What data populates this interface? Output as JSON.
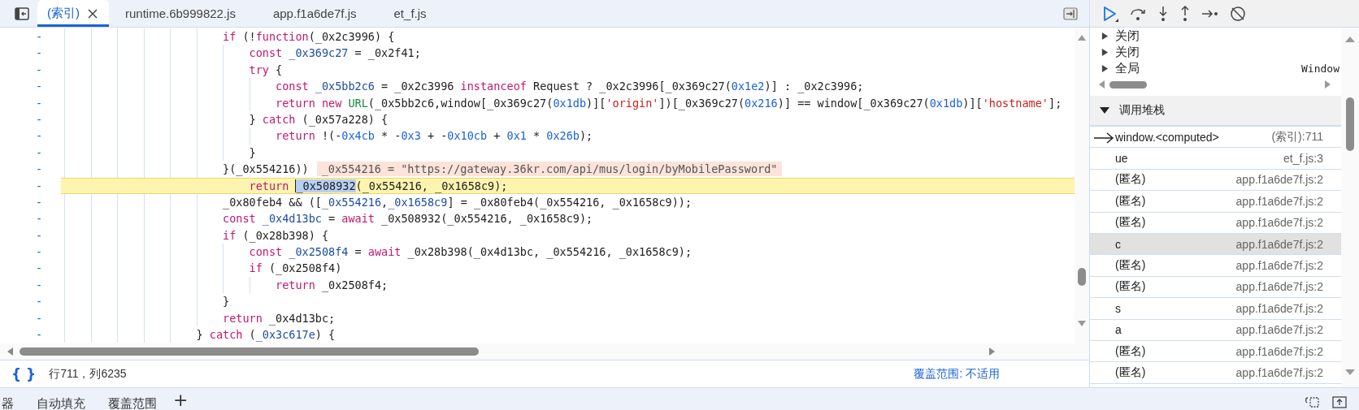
{
  "editor": {
    "tabs": [
      {
        "label": "(索引)",
        "selected": true
      },
      {
        "label": "runtime.6b999822.js",
        "selected": false
      },
      {
        "label": "app.f1a6de7f.js",
        "selected": false
      },
      {
        "label": "et_f.js",
        "selected": false
      }
    ],
    "lines": [
      {
        "kind": "code",
        "gutter": "-",
        "current": false,
        "tokens": [
          {
            "t": "if",
            "kind": "kw"
          },
          {
            "t": " (!",
            "kind": "p"
          },
          {
            "t": "function",
            "kind": "kw"
          },
          {
            "t": "(_0x2c3996) {",
            "kind": "p"
          }
        ],
        "children": [
          {
            "kind": "code",
            "gutter": "-",
            "current": false,
            "tokens": [
              {
                "t": "const ",
                "kind": "kw"
              },
              {
                "t": "_0x369c27",
                "kind": "def"
              },
              {
                "t": " = _0x2f41;",
                "kind": "p"
              }
            ]
          },
          {
            "kind": "code",
            "gutter": "-",
            "current": false,
            "tokens": [
              {
                "t": "try",
                "kind": "kw"
              },
              {
                "t": " {",
                "kind": "p"
              }
            ],
            "children": [
              {
                "kind": "code",
                "gutter": "-",
                "current": false,
                "tokens": [
                  {
                    "t": "const ",
                    "kind": "kw"
                  },
                  {
                    "t": "_0x5bb2c6",
                    "kind": "def"
                  },
                  {
                    "t": " = _0x2c3996 ",
                    "kind": "p"
                  },
                  {
                    "t": "instanceof",
                    "kind": "kw"
                  },
                  {
                    "t": " Request ? _0x2c3996[_0x369c27(",
                    "kind": "p"
                  },
                  {
                    "t": "0x1e2",
                    "kind": "num"
                  },
                  {
                    "t": ")] : _0x2c3996;",
                    "kind": "p"
                  }
                ]
              },
              {
                "kind": "code",
                "gutter": "-",
                "current": false,
                "tokens": [
                  {
                    "t": "return new ",
                    "kind": "kw"
                  },
                  {
                    "t": "URL",
                    "kind": "fn"
                  },
                  {
                    "t": "(_0x5bb2c6,window[_0x369c27(",
                    "kind": "p"
                  },
                  {
                    "t": "0x1db",
                    "kind": "num"
                  },
                  {
                    "t": ")][",
                    "kind": "p"
                  },
                  {
                    "t": "'origin'",
                    "kind": "str"
                  },
                  {
                    "t": "])[_0x369c27(",
                    "kind": "p"
                  },
                  {
                    "t": "0x216",
                    "kind": "num"
                  },
                  {
                    "t": ")] == window[_0x369c27(",
                    "kind": "p"
                  },
                  {
                    "t": "0x1db",
                    "kind": "num"
                  },
                  {
                    "t": ")][",
                    "kind": "p"
                  },
                  {
                    "t": "'hostname'",
                    "kind": "str"
                  },
                  {
                    "t": "];",
                    "kind": "p"
                  }
                ]
              }
            ]
          },
          {
            "kind": "code",
            "gutter": "-",
            "current": false,
            "tokens": [
              {
                "t": "} ",
                "kind": "p"
              },
              {
                "t": "catch",
                "kind": "kw"
              },
              {
                "t": " (_0x57a228) {",
                "kind": "p"
              }
            ],
            "children": [
              {
                "kind": "code",
                "gutter": "-",
                "current": false,
                "tokens": [
                  {
                    "t": "return",
                    "kind": "kw"
                  },
                  {
                    "t": " !(-",
                    "kind": "p"
                  },
                  {
                    "t": "0x4cb",
                    "kind": "num"
                  },
                  {
                    "t": " * -",
                    "kind": "p"
                  },
                  {
                    "t": "0x3",
                    "kind": "num"
                  },
                  {
                    "t": " + -",
                    "kind": "p"
                  },
                  {
                    "t": "0x10cb",
                    "kind": "num"
                  },
                  {
                    "t": " + ",
                    "kind": "p"
                  },
                  {
                    "t": "0x1",
                    "kind": "num"
                  },
                  {
                    "t": " * ",
                    "kind": "p"
                  },
                  {
                    "t": "0x26b",
                    "kind": "num"
                  },
                  {
                    "t": ");",
                    "kind": "p"
                  }
                ]
              }
            ]
          },
          {
            "kind": "code",
            "gutter": "-",
            "current": false,
            "tokens": [
              {
                "t": "}",
                "kind": "p"
              }
            ]
          }
        ]
      },
      {
        "kind": "code",
        "gutter": "-",
        "current": false,
        "tokens": [
          {
            "t": "}(_0x554216))",
            "kind": "p"
          }
        ],
        "inline_value": "_0x554216 = \"https://gateway.36kr.com/api/mus/login/byMobilePassword\"",
        "children": [
          {
            "kind": "code",
            "gutter": "-",
            "current": true,
            "tokens": [
              {
                "t": "return ",
                "kind": "kw"
              },
              {
                "t": "_0x508932",
                "kind": "sel"
              },
              {
                "t": "(_0x554216, _0x1658c9);",
                "kind": "p"
              }
            ]
          }
        ]
      },
      {
        "kind": "code",
        "gutter": "-",
        "current": false,
        "tokens": [
          {
            "t": "_0x80feb4 && ([",
            "kind": "p"
          },
          {
            "t": "_0x554216",
            "kind": "def"
          },
          {
            "t": ",",
            "kind": "p"
          },
          {
            "t": "_0x1658c9",
            "kind": "def"
          },
          {
            "t": "] = _0x80feb4(_0x554216, _0x1658c9));",
            "kind": "p"
          }
        ]
      },
      {
        "kind": "code",
        "gutter": "-",
        "current": false,
        "tokens": [
          {
            "t": "const ",
            "kind": "kw"
          },
          {
            "t": "_0x4d13bc",
            "kind": "def"
          },
          {
            "t": " = ",
            "kind": "p"
          },
          {
            "t": "await",
            "kind": "kw"
          },
          {
            "t": " _0x508932(_0x554216, _0x1658c9);",
            "kind": "p"
          }
        ]
      },
      {
        "kind": "code",
        "gutter": "-",
        "current": false,
        "tokens": [
          {
            "t": "if",
            "kind": "kw"
          },
          {
            "t": " (_0x28b398) {",
            "kind": "p"
          }
        ],
        "children": [
          {
            "kind": "code",
            "gutter": "-",
            "current": false,
            "tokens": [
              {
                "t": "const ",
                "kind": "kw"
              },
              {
                "t": "_0x2508f4",
                "kind": "def"
              },
              {
                "t": " = ",
                "kind": "p"
              },
              {
                "t": "await",
                "kind": "kw"
              },
              {
                "t": " _0x28b398(_0x4d13bc, _0x554216, _0x1658c9);",
                "kind": "p"
              }
            ]
          },
          {
            "kind": "code",
            "gutter": "-",
            "current": false,
            "tokens": [
              {
                "t": "if",
                "kind": "kw"
              },
              {
                "t": " (_0x2508f4)",
                "kind": "p"
              }
            ],
            "children": [
              {
                "kind": "code",
                "gutter": "-",
                "current": false,
                "tokens": [
                  {
                    "t": "return",
                    "kind": "kw"
                  },
                  {
                    "t": " _0x2508f4;",
                    "kind": "p"
                  }
                ]
              }
            ]
          }
        ]
      },
      {
        "kind": "code",
        "gutter": "-",
        "current": false,
        "tokens": [
          {
            "t": "}",
            "kind": "p"
          }
        ]
      },
      {
        "kind": "code",
        "gutter": "-",
        "current": false,
        "tokens": [
          {
            "t": "return",
            "kind": "kw"
          },
          {
            "t": " _0x4d13bc;",
            "kind": "p"
          }
        ]
      },
      {
        "kind": "outer",
        "gutter": "-",
        "current": false,
        "tokens": [
          {
            "t": "} ",
            "kind": "p"
          },
          {
            "t": "catch",
            "kind": "kw"
          },
          {
            "t": " (",
            "kind": "p"
          },
          {
            "t": "_0x3c617e",
            "kind": "def"
          },
          {
            "t": ") {",
            "kind": "p"
          }
        ]
      }
    ],
    "status_bar": {
      "pretty_print": "{ }",
      "position": "行711，列6235",
      "coverage": "覆盖范围: 不适用"
    }
  },
  "debugger": {
    "scope": [
      {
        "name": "关闭",
        "expanded": false
      },
      {
        "name": "关闭",
        "expanded": false
      },
      {
        "name": "全局",
        "value": "Window",
        "expanded": false
      }
    ],
    "call_stack": {
      "title": "调用堆栈",
      "expanded": true,
      "frames": [
        {
          "name": "window.<computed>",
          "location": "(索引):711",
          "selected": true,
          "hovered": false
        },
        {
          "name": "ue",
          "location": "et_f.js:3",
          "selected": false,
          "hovered": false
        },
        {
          "name": "(匿名)",
          "location": "app.f1a6de7f.js:2",
          "selected": false,
          "hovered": false
        },
        {
          "name": "(匿名)",
          "location": "app.f1a6de7f.js:2",
          "selected": false,
          "hovered": false
        },
        {
          "name": "(匿名)",
          "location": "app.f1a6de7f.js:2",
          "selected": false,
          "hovered": false
        },
        {
          "name": "c",
          "location": "app.f1a6de7f.js:2",
          "selected": false,
          "hovered": true
        },
        {
          "name": "(匿名)",
          "location": "app.f1a6de7f.js:2",
          "selected": false,
          "hovered": false
        },
        {
          "name": "(匿名)",
          "location": "app.f1a6de7f.js:2",
          "selected": false,
          "hovered": false
        },
        {
          "name": "s",
          "location": "app.f1a6de7f.js:2",
          "selected": false,
          "hovered": false
        },
        {
          "name": "a",
          "location": "app.f1a6de7f.js:2",
          "selected": false,
          "hovered": false
        },
        {
          "name": "(匿名)",
          "location": "app.f1a6de7f.js:2",
          "selected": false,
          "hovered": false
        },
        {
          "name": "(匿名)",
          "location": "app.f1a6de7f.js:2",
          "selected": false,
          "hovered": false
        }
      ]
    }
  },
  "drawer": {
    "tabs": [
      {
        "label": "器"
      },
      {
        "label": "自动填充"
      },
      {
        "label": "覆盖范围"
      }
    ],
    "add": "+"
  }
}
